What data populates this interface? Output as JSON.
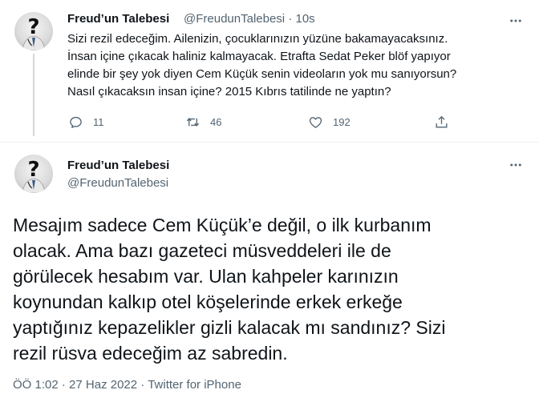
{
  "tweet1": {
    "display_name": "Freud’un Talebesi",
    "handle": "@FreudunTalebesi",
    "separator": "·",
    "time": "10s",
    "lines": [
      "Sizi rezil edeceğim. Ailenizin, çocuklarınızın yüzüne bakamayacaksınız.",
      "İnsan içine çıkacak haliniz kalmayacak. Etrafta Sedat Peker blöf yapıyor",
      "elinde bir şey yok diyen Cem Küçük senin videoların yok mu sanıyorsun?",
      "Nasıl çıkacaksın insan içine? 2015 Kıbrıs tatilinde ne yaptın?"
    ],
    "replies": "11",
    "retweets": "46",
    "likes": "192"
  },
  "tweet2": {
    "display_name": "Freud’un Talebesi",
    "handle": "@FreudunTalebesi",
    "lines": [
      "Mesajım sadece Cem Küçük’e değil, o ilk kurbanım",
      "olacak. Ama bazı gazeteci müsveddeleri ile de",
      "görülecek hesabım var. Ulan kahpeler karınızın",
      "koynundan kalkıp otel köşelerinde erkek erkeğe",
      "yaptığınız kepazelikler gizli kalacak mı sandınız? Sizi",
      "rezil rüsva edeceğim az sabredin."
    ],
    "time": "ÖÖ 1:02",
    "date": "27 Haz 2022",
    "separator": "·",
    "source": "Twitter for iPhone"
  },
  "icons": [
    "avatar-question-mark",
    "more-icon",
    "reply-icon",
    "retweet-icon",
    "like-icon",
    "share-icon"
  ]
}
